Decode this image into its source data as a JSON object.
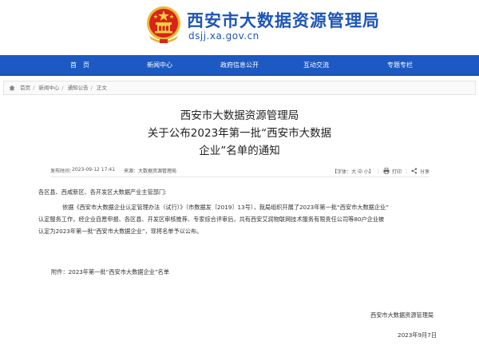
{
  "header": {
    "site_name": "西安市大数据资源管理局",
    "domain": "dsjj.xa.gov.cn"
  },
  "nav": {
    "items": [
      "首　页",
      "新闻中心",
      "政府信息公开",
      "互动交流",
      "专题专栏"
    ]
  },
  "breadcrumb": {
    "items": [
      "首页",
      "新闻中心",
      "通知公告",
      "正文"
    ]
  },
  "article": {
    "title_lines": [
      "西安市大数据资源管理局",
      "关于公布2023年第一批“西安市大数据",
      "企业”名单的通知"
    ],
    "publish_label": "发布时间：",
    "publish_time": "2023-09-12 17:41",
    "source_label": "来源：",
    "source": "大数据资源管理局",
    "font_size_label": "【字体：大 中 小】",
    "print_label": "打印",
    "share_label": "分享",
    "salutation": "各区县、西咸新区、各开发区大数据产业主管部门:",
    "paragraph_lines": [
      "依据《西安市大数据企业认定管理办法（试行）》（市数据发〔2019〕13号），我局组织开展了2023年第一批“西安市大数据企业”",
      "认定服务工作，经企业自愿申报、各区县、开发区审核推荐、专家综合评审后，共有西安艾润物联网技术服务有限责任公司等80户企业被",
      "认定为2023年第一批“西安市大数据企业”，现将名单予以公布。"
    ],
    "attachment": "附件：2023年第一批“西安市大数据企业”名单",
    "signature": "西安市大数据资源管理局",
    "date": "2023年9月7日"
  },
  "colors": {
    "brand_blue": "#1d56b8",
    "nav_blue": "#1d59c2",
    "emblem_red": "#d8231b",
    "emblem_gold": "#e9b830"
  }
}
